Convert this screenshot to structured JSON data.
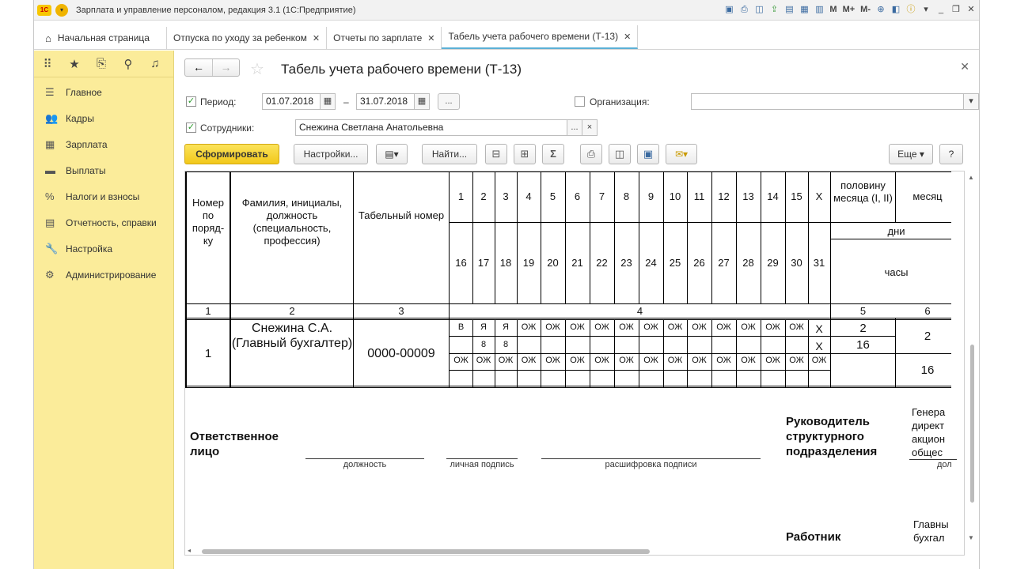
{
  "app": {
    "title": "Зарплата и управление персоналом, редакция 3.1  (1С:Предприятие)"
  },
  "titlebar_icons": [
    "save-icon",
    "print-icon",
    "preview-icon",
    "upload-icon",
    "attach-icon",
    "calendar-icon",
    "table-icon",
    "M",
    "M+",
    "M-",
    "zoom-icon",
    "panel-icon",
    "info-icon",
    "minimize-icon",
    "restore-icon",
    "close-icon"
  ],
  "tabs": [
    {
      "label": "Начальная страница"
    },
    {
      "label": "Отпуска по уходу за ребенком"
    },
    {
      "label": "Отчеты по зарплате"
    },
    {
      "label": "Табель учета рабочего времени (Т-13)"
    }
  ],
  "sidebar": {
    "items": [
      {
        "label": "Главное",
        "icon": "menu-icon"
      },
      {
        "label": "Кадры",
        "icon": "people-icon"
      },
      {
        "label": "Зарплата",
        "icon": "calculator-icon"
      },
      {
        "label": "Выплаты",
        "icon": "wallet-icon"
      },
      {
        "label": "Налоги и взносы",
        "icon": "percent-icon"
      },
      {
        "label": "Отчетность, справки",
        "icon": "reports-icon"
      },
      {
        "label": "Настройка",
        "icon": "wrench-icon"
      },
      {
        "label": "Администрирование",
        "icon": "gear-icon"
      }
    ]
  },
  "form": {
    "title": "Табель учета рабочего времени (Т-13)",
    "period_label": "Период:",
    "period_from": "01.07.2018",
    "period_dash": "–",
    "period_to": "31.07.2018",
    "period_more": "...",
    "org_label": "Организация:",
    "org_value": "",
    "employees_label": "Сотрудники:",
    "employees_value": "Снежина Светлана Анатольевна",
    "more": "...",
    "clear": "×"
  },
  "toolbar": {
    "generate": "Сформировать",
    "settings": "Настройки...",
    "find": "Найти...",
    "sum": "Σ",
    "more": "Еще",
    "help": "?"
  },
  "report": {
    "headers": {
      "num": "Номер по поряд- ку",
      "name": "Фамилия, инициалы, должность (специальность, профессия)",
      "tab": "Табельный номер",
      "half": "половину месяца (I, II)",
      "month": "месяц",
      "days": "дни",
      "hours": "часы"
    },
    "days_row1": [
      "1",
      "2",
      "3",
      "4",
      "5",
      "6",
      "7",
      "8",
      "9",
      "10",
      "11",
      "12",
      "13",
      "14",
      "15",
      "X"
    ],
    "days_row2": [
      "16",
      "17",
      "18",
      "19",
      "20",
      "21",
      "22",
      "23",
      "24",
      "25",
      "26",
      "27",
      "28",
      "29",
      "30",
      "31"
    ],
    "col_numbers": [
      "1",
      "2",
      "3",
      "4",
      "5",
      "6"
    ],
    "row": {
      "num": "1",
      "name": "Снежина С.А. (Главный бухгалтер)",
      "tab": "0000-00009",
      "marks1": [
        "В",
        "Я",
        "Я",
        "ОЖ",
        "ОЖ",
        "ОЖ",
        "ОЖ",
        "ОЖ",
        "ОЖ",
        "ОЖ",
        "ОЖ",
        "ОЖ",
        "ОЖ",
        "ОЖ",
        "ОЖ",
        "Х"
      ],
      "hours1": [
        "",
        "8",
        "8",
        "",
        "",
        "",
        "",
        "",
        "",
        "",
        "",
        "",
        "",
        "",
        "",
        "Х"
      ],
      "marks2": [
        "ОЖ",
        "ОЖ",
        "ОЖ",
        "ОЖ",
        "ОЖ",
        "ОЖ",
        "ОЖ",
        "ОЖ",
        "ОЖ",
        "ОЖ",
        "ОЖ",
        "ОЖ",
        "ОЖ",
        "ОЖ",
        "ОЖ",
        "ОЖ"
      ],
      "half1_days": "2",
      "half1_hours": "16",
      "month_days": "2",
      "month_hours": "16"
    },
    "signatures": {
      "responsible": "Ответственное лицо",
      "position": "должность",
      "personal_sign": "личная подпись",
      "decoding": "расшифровка подписи",
      "head": "Руководитель структурного подразделения",
      "head_position_text": "Генера директ акцион общес",
      "head_position_lbl": "дол",
      "worker": "Работник",
      "worker_position_text": "Главны бухгал"
    }
  }
}
